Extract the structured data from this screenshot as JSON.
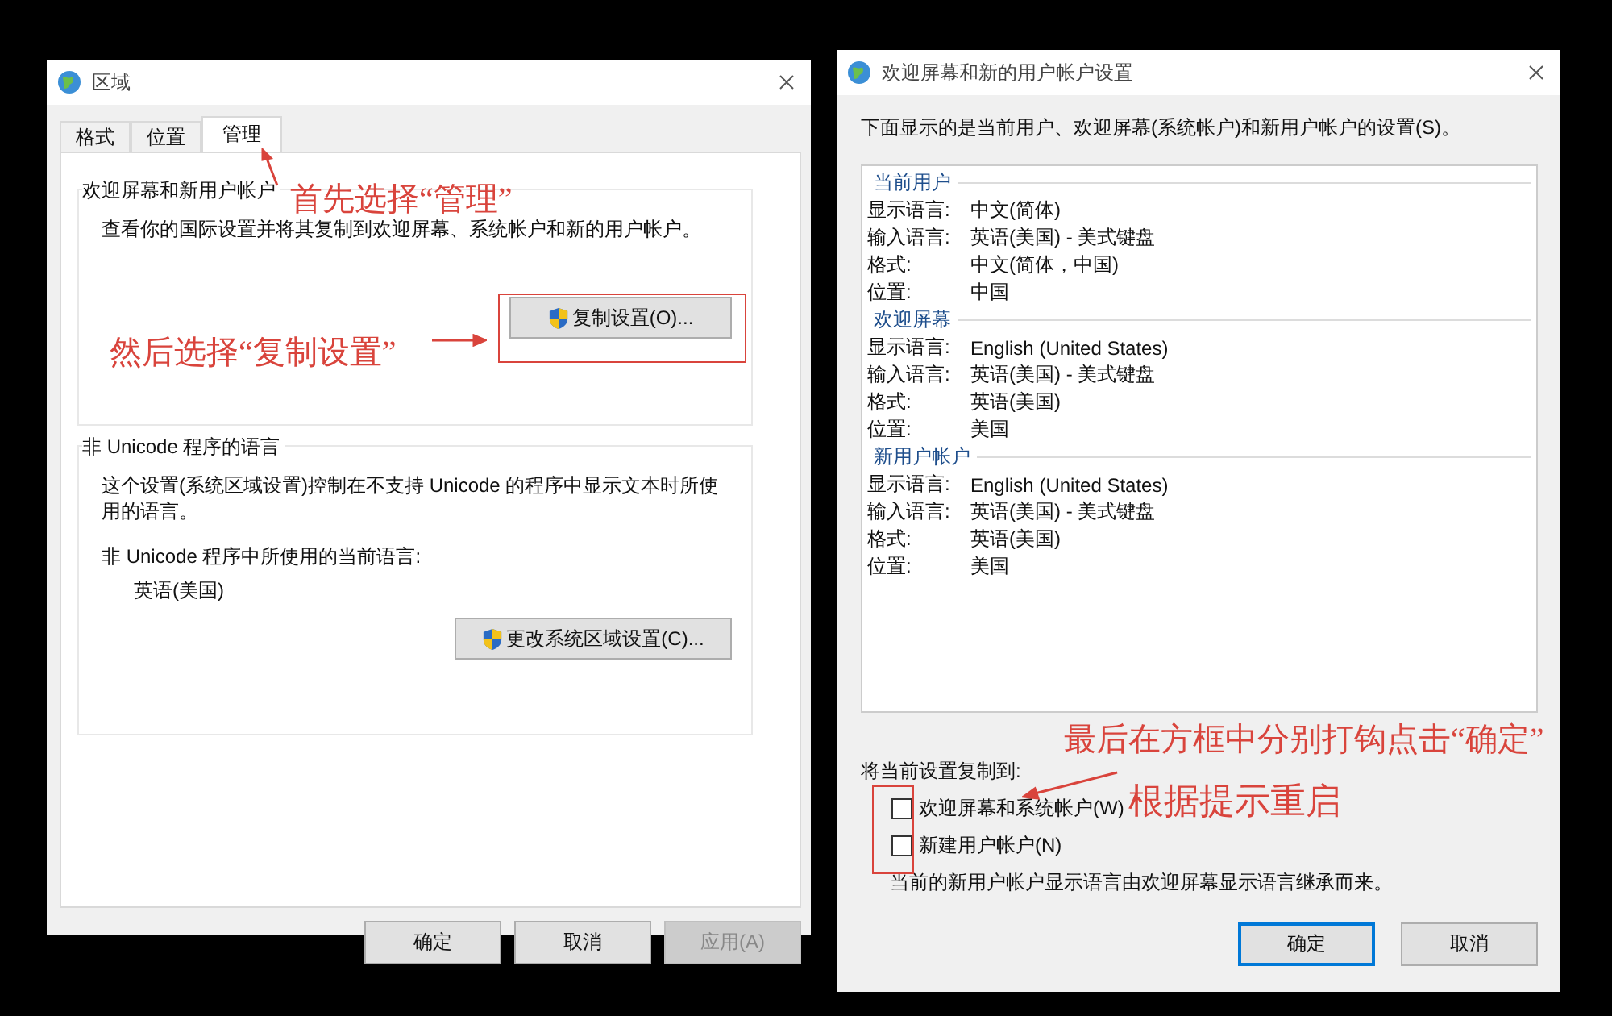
{
  "region_dialog": {
    "title": "区域",
    "tabs": [
      {
        "label": "格式",
        "selected": false
      },
      {
        "label": "位置",
        "selected": false
      },
      {
        "label": "管理",
        "selected": true
      }
    ],
    "welcome_group": {
      "legend": "欢迎屏幕和新用户帐户",
      "description": "查看你的国际设置并将其复制到欢迎屏幕、系统帐户和新的用户帐户。",
      "button": "复制设置(O)..."
    },
    "unicode_group": {
      "legend": "非 Unicode 程序的语言",
      "description": "这个设置(系统区域设置)控制在不支持 Unicode 的程序中显示文本时所使用的语言。",
      "current_label": "非 Unicode 程序中所使用的当前语言:",
      "current_value": "英语(美国)",
      "button": "更改系统区域设置(C)..."
    },
    "buttons": [
      {
        "label": "确定",
        "disabled": false
      },
      {
        "label": "取消",
        "disabled": false
      },
      {
        "label": "应用(A)",
        "disabled": true
      }
    ]
  },
  "welcome_dialog": {
    "title": "欢迎屏幕和新的用户帐户设置",
    "intro": "下面显示的是当前用户、欢迎屏幕(系统帐户)和新用户帐户的设置(S)。",
    "sections": [
      {
        "heading": "当前用户",
        "rows": [
          {
            "label": "显示语言:",
            "value": "中文(简体)"
          },
          {
            "label": "输入语言:",
            "value": "英语(美国) - 美式键盘"
          },
          {
            "label": "格式:",
            "value": "中文(简体，中国)"
          },
          {
            "label": "位置:",
            "value": "中国"
          }
        ]
      },
      {
        "heading": "欢迎屏幕",
        "rows": [
          {
            "label": "显示语言:",
            "value": "English (United States)"
          },
          {
            "label": "输入语言:",
            "value": "英语(美国) - 美式键盘"
          },
          {
            "label": "格式:",
            "value": "英语(美国)"
          },
          {
            "label": "位置:",
            "value": "美国"
          }
        ]
      },
      {
        "heading": "新用户帐户",
        "rows": [
          {
            "label": "显示语言:",
            "value": "English (United States)"
          },
          {
            "label": "输入语言:",
            "value": "英语(美国) - 美式键盘"
          },
          {
            "label": "格式:",
            "value": "英语(美国)"
          },
          {
            "label": "位置:",
            "value": "美国"
          }
        ]
      }
    ],
    "copy_label": "将当前设置复制到:",
    "options": [
      {
        "label": "欢迎屏幕和系统帐户(W)",
        "checked": false
      },
      {
        "label": "新建用户帐户(N)",
        "checked": false
      }
    ],
    "note": "当前的新用户帐户显示语言由欢迎屏幕显示语言继承而来。",
    "buttons": [
      {
        "label": "确定",
        "default": true
      },
      {
        "label": "取消",
        "default": false
      }
    ]
  },
  "annotations": [
    {
      "text": "首先选择“管理”"
    },
    {
      "text": "然后选择“复制设置”"
    },
    {
      "text": "最后在方框中分别打钩点击“确定”"
    },
    {
      "text": "根据提示重启"
    }
  ]
}
